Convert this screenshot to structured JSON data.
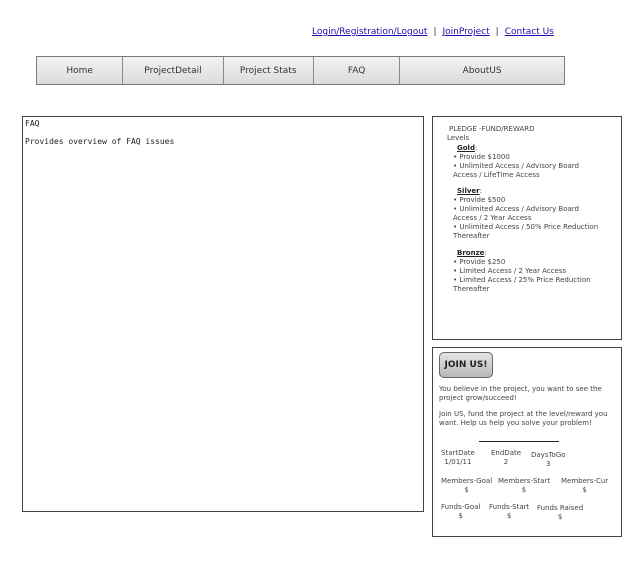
{
  "top_links": {
    "login": "Login/Registration/Logout",
    "sep": "|",
    "join_project": "JoinProject",
    "contact": "Contact Us"
  },
  "nav": {
    "home": "Home",
    "project_detail": "ProjectDetail",
    "project_stats": "Project Stats",
    "faq": "FAQ",
    "about": "AboutUS"
  },
  "faq": {
    "title": "FAQ",
    "description": "Provides overview of FAQ issues"
  },
  "pledge": {
    "header": "PLEDGE -FUND/REWARD",
    "levels_label": "Levels",
    "gold": {
      "name": "Gold",
      "line1": "• Provide $1000",
      "line2": "• Unlimited Access / Advisory Board Access / LifeTime Access"
    },
    "silver": {
      "name": "Silver",
      "line1": "• Provide $500",
      "line2": "• Unlimited Access / Advisory Board Access / 2 Year Access",
      "line3": "• Unlimited Access / 50% Price Reduction Thereafter"
    },
    "bronze": {
      "name": "Bronze",
      "line1": "• Provide $250",
      "line2": "• Limited Access /  2 Year Access",
      "line3": "• Limited Access / 25% Price Reduction Thereafter"
    }
  },
  "join": {
    "button": "JOIN US!",
    "para1": "You believe in the project, you want  to see the project grow/succeed!",
    "para2": "Join US, fund the project at the level/reward you want. Help us help you solve your problem!",
    "stats": {
      "start_date_label": "StartDate",
      "start_date_value": "1/01/11",
      "end_date_label": "EndDate",
      "end_date_value": "2",
      "days_to_go_label": "DaysToGo",
      "days_to_go_value": "3",
      "members_goal_label": "Members-Goal",
      "members_goal_value": "$",
      "members_start_label": "Members-Start",
      "members_start_value": "$",
      "members_cur_label": "Members-Cur",
      "members_cur_value": "$",
      "funds_goal_label": "Funds-Goal",
      "funds_goal_value": "$",
      "funds_start_label": "Funds-Start",
      "funds_start_value": "$",
      "funds_raised_label": "Funds Raised",
      "funds_raised_value": "$"
    }
  }
}
